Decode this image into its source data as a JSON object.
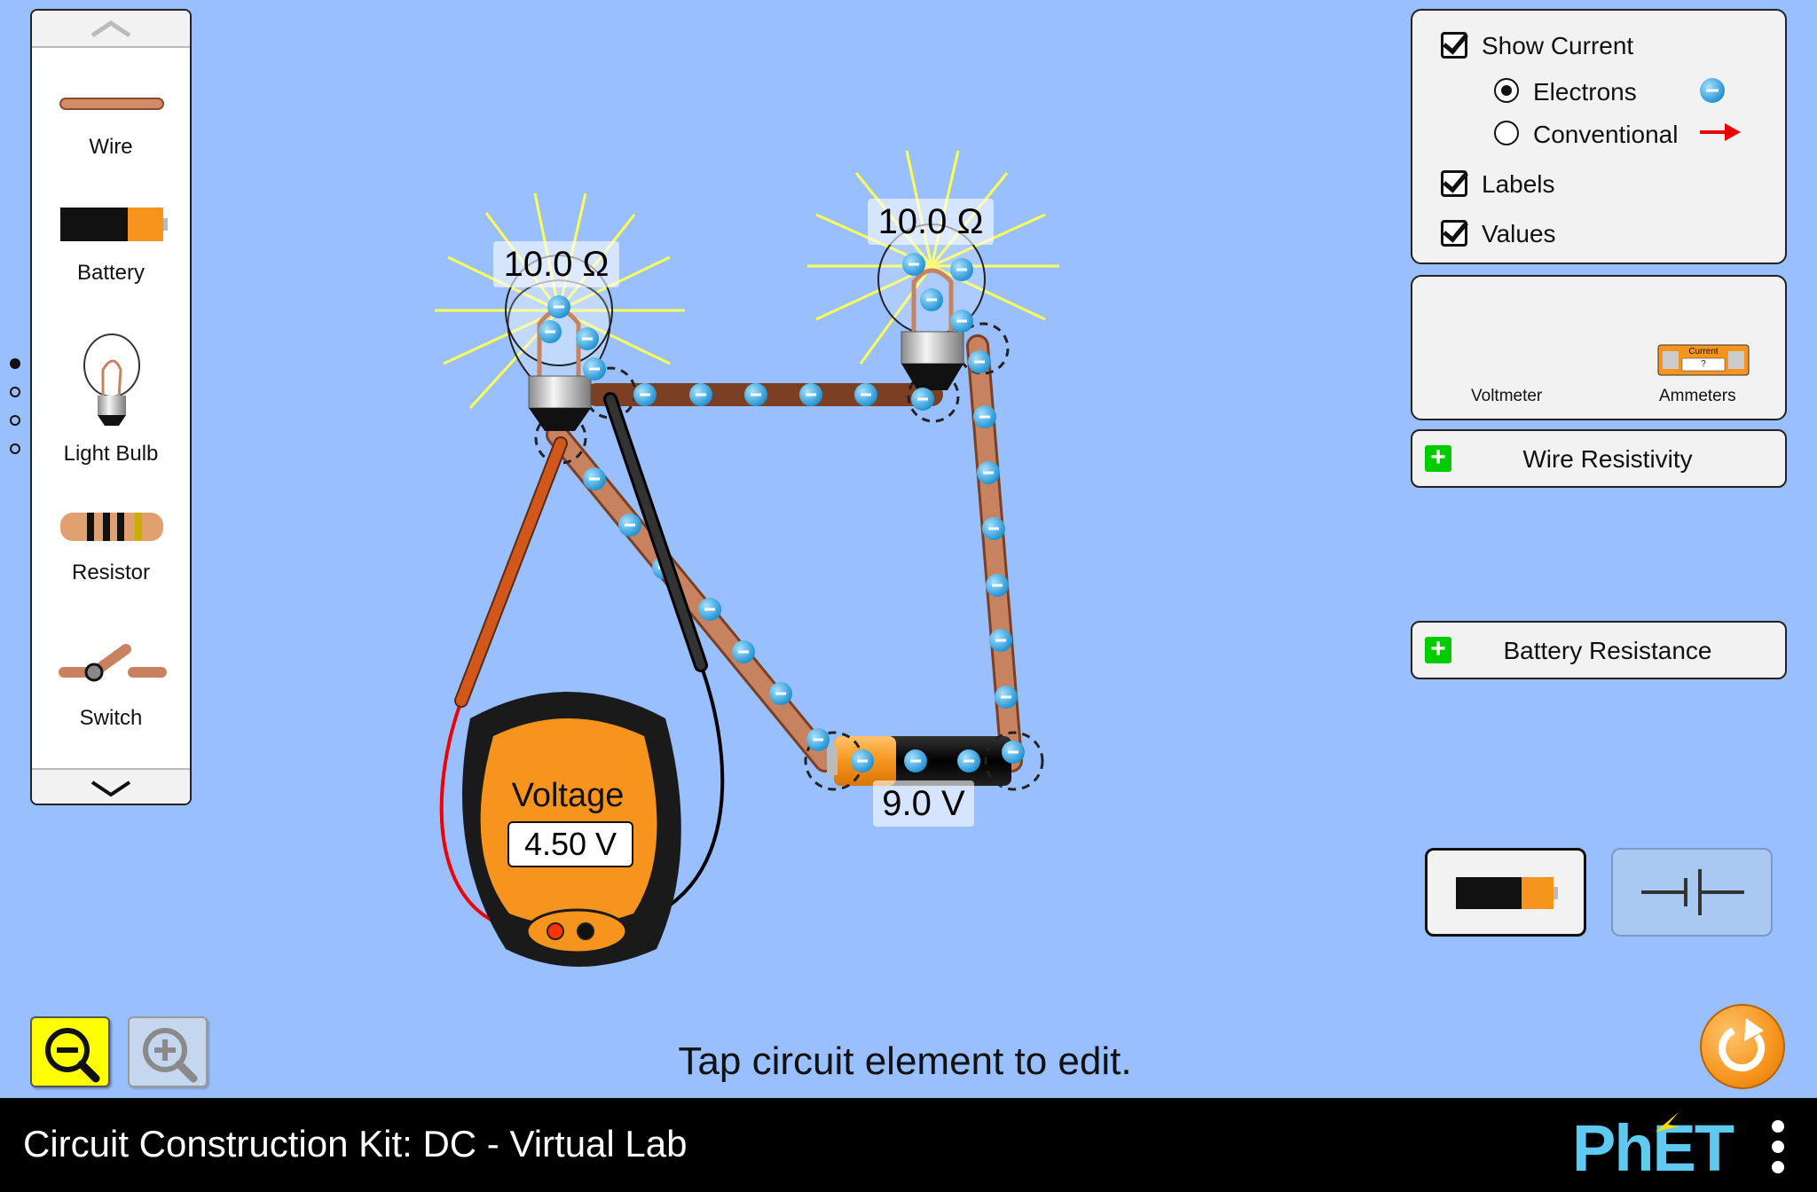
{
  "window": {
    "title": "Circuit Construction Kit: DC - Virtual Lab",
    "logo_text": "PhET"
  },
  "toolbox": {
    "items": [
      {
        "label": "Wire",
        "icon": "wire-icon"
      },
      {
        "label": "Battery",
        "icon": "battery-icon"
      },
      {
        "label": "Light Bulb",
        "icon": "light-bulb-icon"
      },
      {
        "label": "Resistor",
        "icon": "resistor-icon"
      },
      {
        "label": "Switch",
        "icon": "switch-icon"
      }
    ],
    "page_count": 4,
    "active_page": 1
  },
  "options": {
    "show_current": {
      "label": "Show Current",
      "checked": true
    },
    "electrons": {
      "label": "Electrons",
      "selected": true
    },
    "conventional": {
      "label": "Conventional",
      "selected": false
    },
    "labels": {
      "label": "Labels",
      "checked": true
    },
    "values": {
      "label": "Values",
      "checked": true
    }
  },
  "sensors": {
    "voltmeter_label": "Voltmeter",
    "ammeters_label": "Ammeters",
    "ammeter_text": "Current",
    "ammeter_reading": "?"
  },
  "accordions": {
    "wire_resistivity": "Wire Resistivity",
    "battery_resistance": "Battery Resistance"
  },
  "circuit": {
    "bulb1_value": "10.0 Ω",
    "bulb2_value": "10.0 Ω",
    "battery_value": "9.0 V"
  },
  "voltmeter": {
    "title": "Voltage",
    "reading": "4.50 V"
  },
  "status": {
    "hint": "Tap circuit element to edit."
  },
  "colors": {
    "background": "#99bfff",
    "electron": "#2ea8e6",
    "wire": "#c7835f",
    "voltmeter_body": "#f7941d",
    "zoom_out_active": "#ffff00",
    "reset": "#f7941d"
  }
}
